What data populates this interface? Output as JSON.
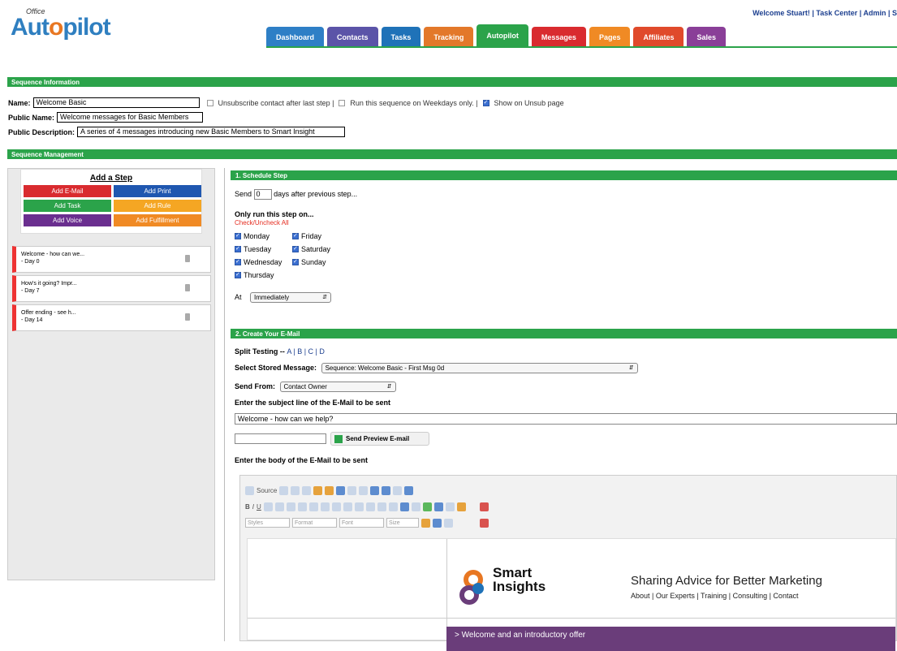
{
  "header": {
    "logo_super": "Office",
    "logo_a": "Aut",
    "logo_o": "o",
    "logo_b": "pilot",
    "welcome": "Welcome Stuart! | Task Center | Admin | S",
    "tabs": [
      {
        "label": "Dashboard",
        "color": "#2e7fc6"
      },
      {
        "label": "Contacts",
        "color": "#5b54a8"
      },
      {
        "label": "Tasks",
        "color": "#1f72b8"
      },
      {
        "label": "Tracking",
        "color": "#e3782a"
      },
      {
        "label": "Autopilot",
        "color": "#2ba34a"
      },
      {
        "label": "Messages",
        "color": "#d92b2f"
      },
      {
        "label": "Pages",
        "color": "#f08a24"
      },
      {
        "label": "Affiliates",
        "color": "#e04a2b"
      },
      {
        "label": "Sales",
        "color": "#8a3f98"
      }
    ]
  },
  "sequence_info": {
    "title": "Sequence Information",
    "name_label": "Name:",
    "name_value": "Welcome Basic",
    "unsubscribe_label": "Unsubscribe contact after last step |",
    "weekdays_label": "Run this sequence on Weekdays only. |",
    "show_unsub_label": "Show on Unsub page",
    "public_name_label": "Public Name:",
    "public_name_value": "Welcome messages for Basic Members",
    "public_desc_label": "Public Description:",
    "public_desc_value": "A series of 4 messages introducing new Basic Members to Smart Insight"
  },
  "sequence_mgmt": {
    "title": "Sequence Management"
  },
  "add_step": {
    "title": "Add a Step",
    "buttons": [
      {
        "label": "Add E-Mail",
        "color": "#d92b2f"
      },
      {
        "label": "Add Print",
        "color": "#1f57b0"
      },
      {
        "label": "Add Task",
        "color": "#2ba34a"
      },
      {
        "label": "Add Rule",
        "color": "#f5a623"
      },
      {
        "label": "Add Voice",
        "color": "#6a2e8f"
      },
      {
        "label": "Add Fulfillment",
        "color": "#f08a24"
      }
    ]
  },
  "steps": [
    {
      "title": "Welcome - how can we...",
      "day": "- Day 0"
    },
    {
      "title": "How's it going? Impr...",
      "day": "- Day 7"
    },
    {
      "title": "Offer ending - see h...",
      "day": "- Day 14"
    }
  ],
  "schedule": {
    "title": "1. Schedule Step",
    "send_pre": "Send",
    "send_days": "0",
    "send_post": "days after previous step...",
    "only_run": "Only run this step on...",
    "check_all": "Check/Uncheck All",
    "days_left": [
      "Monday",
      "Tuesday",
      "Wednesday",
      "Thursday"
    ],
    "days_right": [
      "Friday",
      "Saturday",
      "Sunday"
    ],
    "at_label": "At",
    "at_value": "Immediately"
  },
  "email": {
    "title": "2. Create Your E-Mail",
    "split_label": "Split Testing --",
    "split_options": "A | B | C | D",
    "stored_label": "Select Stored Message:",
    "stored_value": "Sequence: Welcome Basic - First Msg 0d",
    "from_label": "Send From:",
    "from_value": "Contact Owner",
    "subject_prompt": "Enter the subject line of the E-Mail to be sent",
    "subject_value": "Welcome - how can we help?",
    "preview_btn": "Send Preview E-mail",
    "body_prompt": "Enter the body of the E-Mail to be sent"
  },
  "editor": {
    "source": "Source",
    "styles": "Styles",
    "format": "Format",
    "font": "Font",
    "size": "Size"
  },
  "email_preview": {
    "brand_line1": "Smart",
    "brand_line2": "Insights",
    "tagline": "Sharing Advice for Better Marketing",
    "nav": "About | Our Experts | Training | Consulting | Contact",
    "banner": "> Welcome and an introductory offer"
  }
}
